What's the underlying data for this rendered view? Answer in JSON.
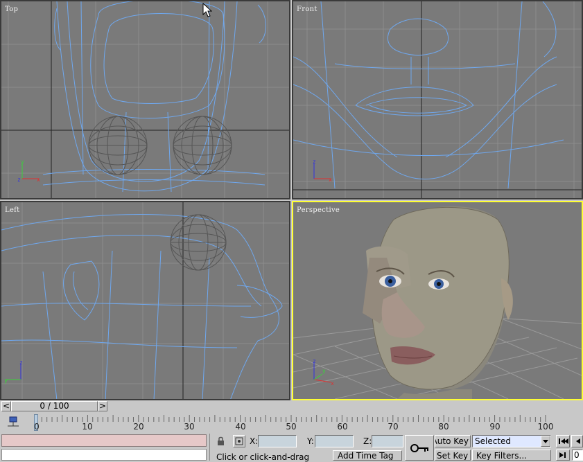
{
  "viewports": {
    "top": {
      "label": "Top"
    },
    "front": {
      "label": "Front"
    },
    "left": {
      "label": "Left"
    },
    "perspective": {
      "label": "Perspective"
    }
  },
  "axes": {
    "x": "x",
    "y": "y",
    "z": "z"
  },
  "time_slider": {
    "label": "0 / 100",
    "prev_glyph": "<",
    "next_glyph": ">"
  },
  "track_bar": {
    "ticks": [
      "0",
      "10",
      "20",
      "30",
      "40",
      "50",
      "60",
      "70",
      "80",
      "90",
      "100"
    ]
  },
  "coords": {
    "x_label": "X:",
    "y_label": "Y:",
    "z_label": "Z:",
    "x_value": "",
    "y_value": "",
    "z_value": ""
  },
  "prompt_line": {
    "text": "Click or click-and-drag",
    "add_time_tag": "Add Time Tag"
  },
  "animation": {
    "auto_key": "Auto Key",
    "set_key": "Set Key",
    "selected_option": "Selected",
    "key_filters": "Key Filters...",
    "frame_value": "0"
  },
  "colors": {
    "active_viewport": "#ffff33",
    "wire": "#6fa8ef",
    "viewport_bg": "#7a7a7a"
  }
}
